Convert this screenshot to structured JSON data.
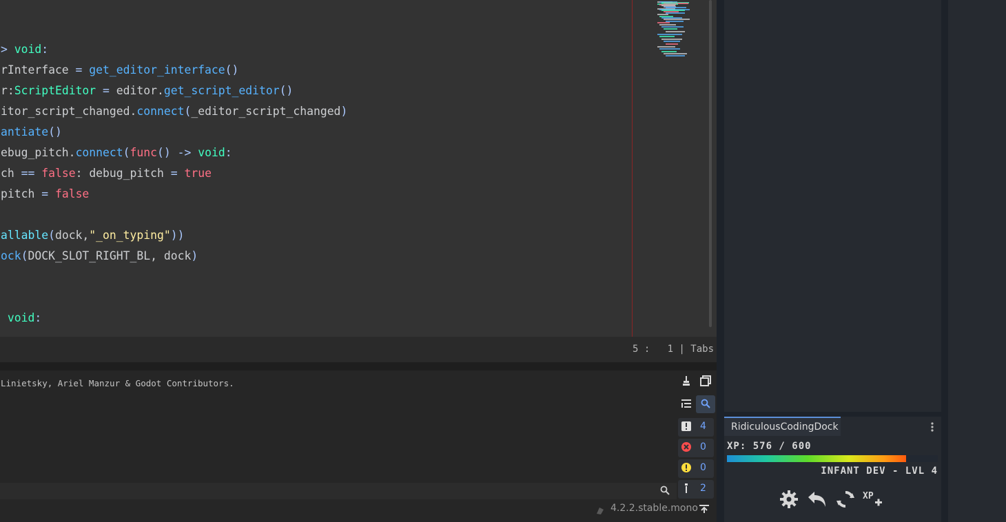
{
  "editor": {
    "lines": [
      [
        {
          "t": "> ",
          "c": "sym"
        },
        {
          "t": "void",
          "c": "ty"
        },
        {
          "t": ":",
          "c": "sym"
        }
      ],
      [
        {
          "t": "rInterface",
          "c": ""
        },
        {
          "t": " = ",
          "c": "sym"
        },
        {
          "t": "get_editor_interface",
          "c": "fn"
        },
        {
          "t": "()",
          "c": "sym"
        }
      ],
      [
        {
          "t": "r:",
          "c": ""
        },
        {
          "t": "ScriptEditor",
          "c": "ty"
        },
        {
          "t": " = ",
          "c": "sym"
        },
        {
          "t": "editor.",
          "c": ""
        },
        {
          "t": "get_script_editor",
          "c": "fn"
        },
        {
          "t": "()",
          "c": "sym"
        }
      ],
      [
        {
          "t": "itor_script_changed.",
          "c": ""
        },
        {
          "t": "connect",
          "c": "fn"
        },
        {
          "t": "(",
          "c": "sym"
        },
        {
          "t": "_editor_script_changed",
          "c": ""
        },
        {
          "t": ")",
          "c": "sym"
        }
      ],
      [
        {
          "t": "antiate",
          "c": "fn"
        },
        {
          "t": "()",
          "c": "sym"
        }
      ],
      [
        {
          "t": "ebug_pitch.",
          "c": ""
        },
        {
          "t": "connect",
          "c": "fn"
        },
        {
          "t": "(",
          "c": "sym"
        },
        {
          "t": "func",
          "c": "kw"
        },
        {
          "t": "() -> ",
          "c": "sym"
        },
        {
          "t": "void",
          "c": "ty"
        },
        {
          "t": ":",
          "c": "sym"
        }
      ],
      [
        {
          "t": "ch ",
          "c": ""
        },
        {
          "t": "==",
          "c": "sym"
        },
        {
          "t": " false",
          "c": "kw"
        },
        {
          "t": ": debug_pitch ",
          "c": ""
        },
        {
          "t": "=",
          "c": "sym"
        },
        {
          "t": " true",
          "c": "kw"
        }
      ],
      [
        {
          "t": "pitch ",
          "c": ""
        },
        {
          "t": "=",
          "c": "sym"
        },
        {
          "t": " false",
          "c": "kw"
        }
      ],
      [],
      [
        {
          "t": "allable",
          "c": "fc"
        },
        {
          "t": "(",
          "c": "sym"
        },
        {
          "t": "dock,",
          "c": ""
        },
        {
          "t": "\"_on_typing\"",
          "c": "st"
        },
        {
          "t": "))",
          "c": "sym"
        }
      ],
      [
        {
          "t": "ock",
          "c": "fn"
        },
        {
          "t": "(",
          "c": "sym"
        },
        {
          "t": "DOCK_SLOT_RIGHT_BL, dock",
          "c": ""
        },
        {
          "t": ")",
          "c": "sym"
        }
      ],
      [],
      [],
      [
        {
          "t": " void",
          "c": "ty"
        },
        {
          "t": ":",
          "c": "sym"
        }
      ]
    ],
    "status": {
      "cursor": "5 :   1 | Tabs"
    }
  },
  "output": {
    "text": "Linietsky, Ariel Manzur & Godot Contributors.",
    "filter_placeholder": "",
    "counts": {
      "messages": "4",
      "errors": "0",
      "warnings": "0",
      "editor": "2"
    },
    "version": "4.2.2.stable.mono"
  },
  "dock": {
    "tab_label": "RidiculousCodingDock",
    "xp_text": "XP: 576 / 600",
    "xp_current": 576,
    "xp_max": 600,
    "rank_text": "INFANT DEV - LVL 4"
  },
  "colors": {
    "accent": "#5c8fd9",
    "error": "#ff4d4d",
    "warning": "#ffde3d",
    "count": "#72a5ff"
  }
}
